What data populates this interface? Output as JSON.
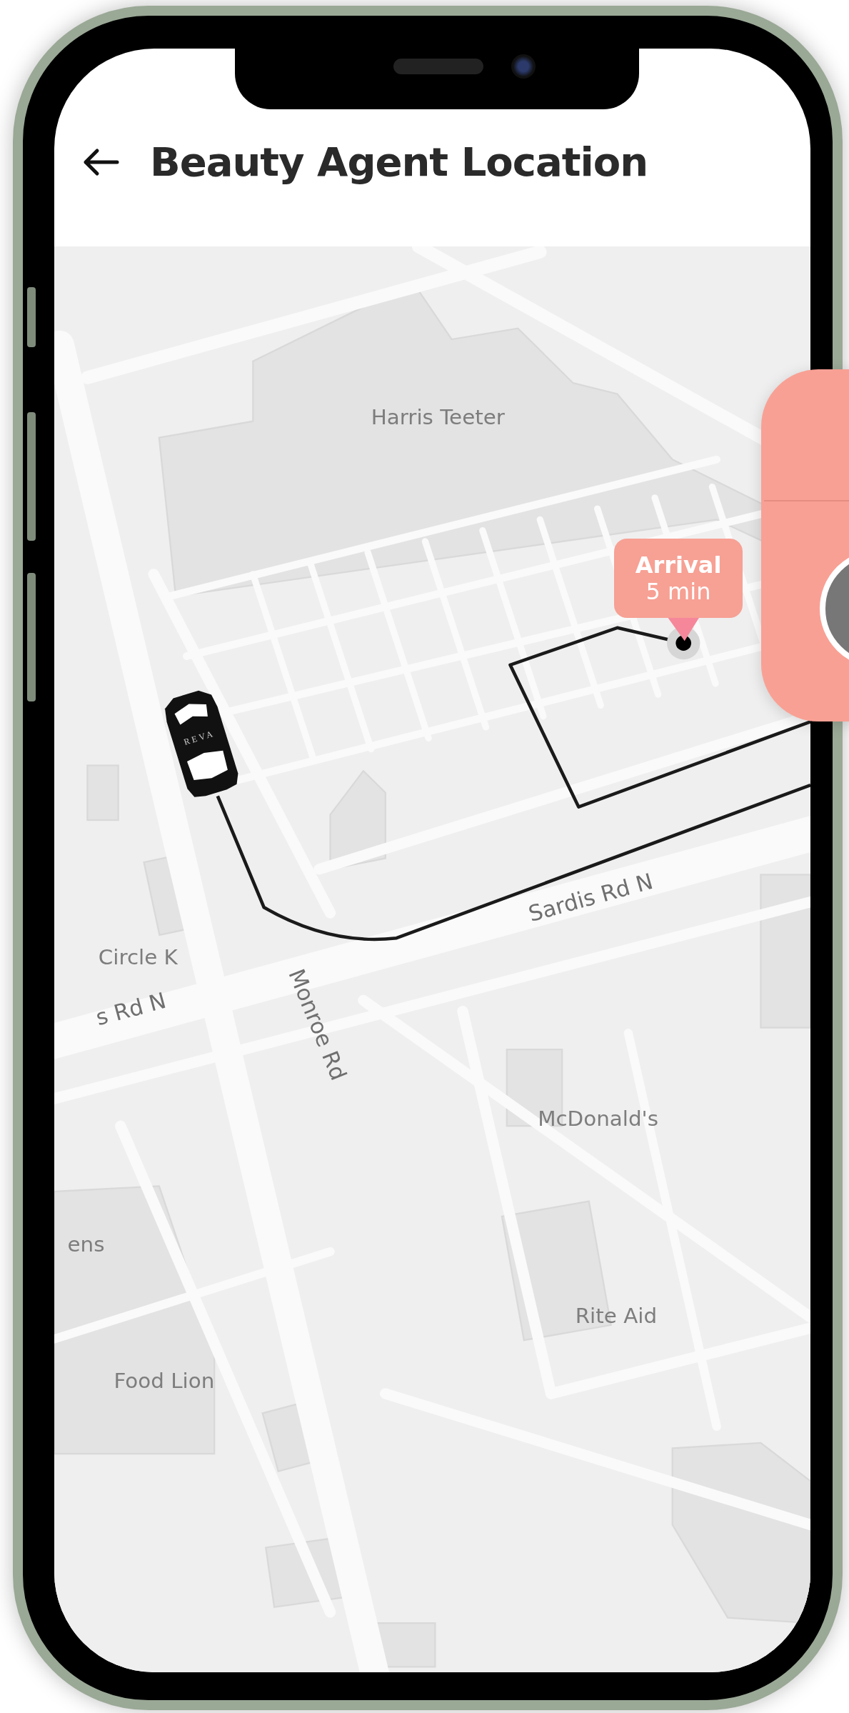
{
  "header": {
    "title": "Beauty Agent Location"
  },
  "map": {
    "labels": [
      {
        "text": "Harris Teeter",
        "kind": "place"
      },
      {
        "text": "Sardis Rd N",
        "kind": "road"
      },
      {
        "text": "Monroe Rd",
        "kind": "road"
      },
      {
        "text": "Circle K",
        "kind": "place"
      },
      {
        "text": "s Rd N",
        "kind": "road"
      },
      {
        "text": "McDonald's",
        "kind": "place"
      },
      {
        "text": "ens",
        "kind": "place"
      },
      {
        "text": "Rite Aid",
        "kind": "place"
      },
      {
        "text": "Food Lion",
        "kind": "place"
      }
    ]
  },
  "arrival": {
    "label": "Arrival",
    "time": "5 min"
  },
  "car": {
    "label": "REVA"
  }
}
